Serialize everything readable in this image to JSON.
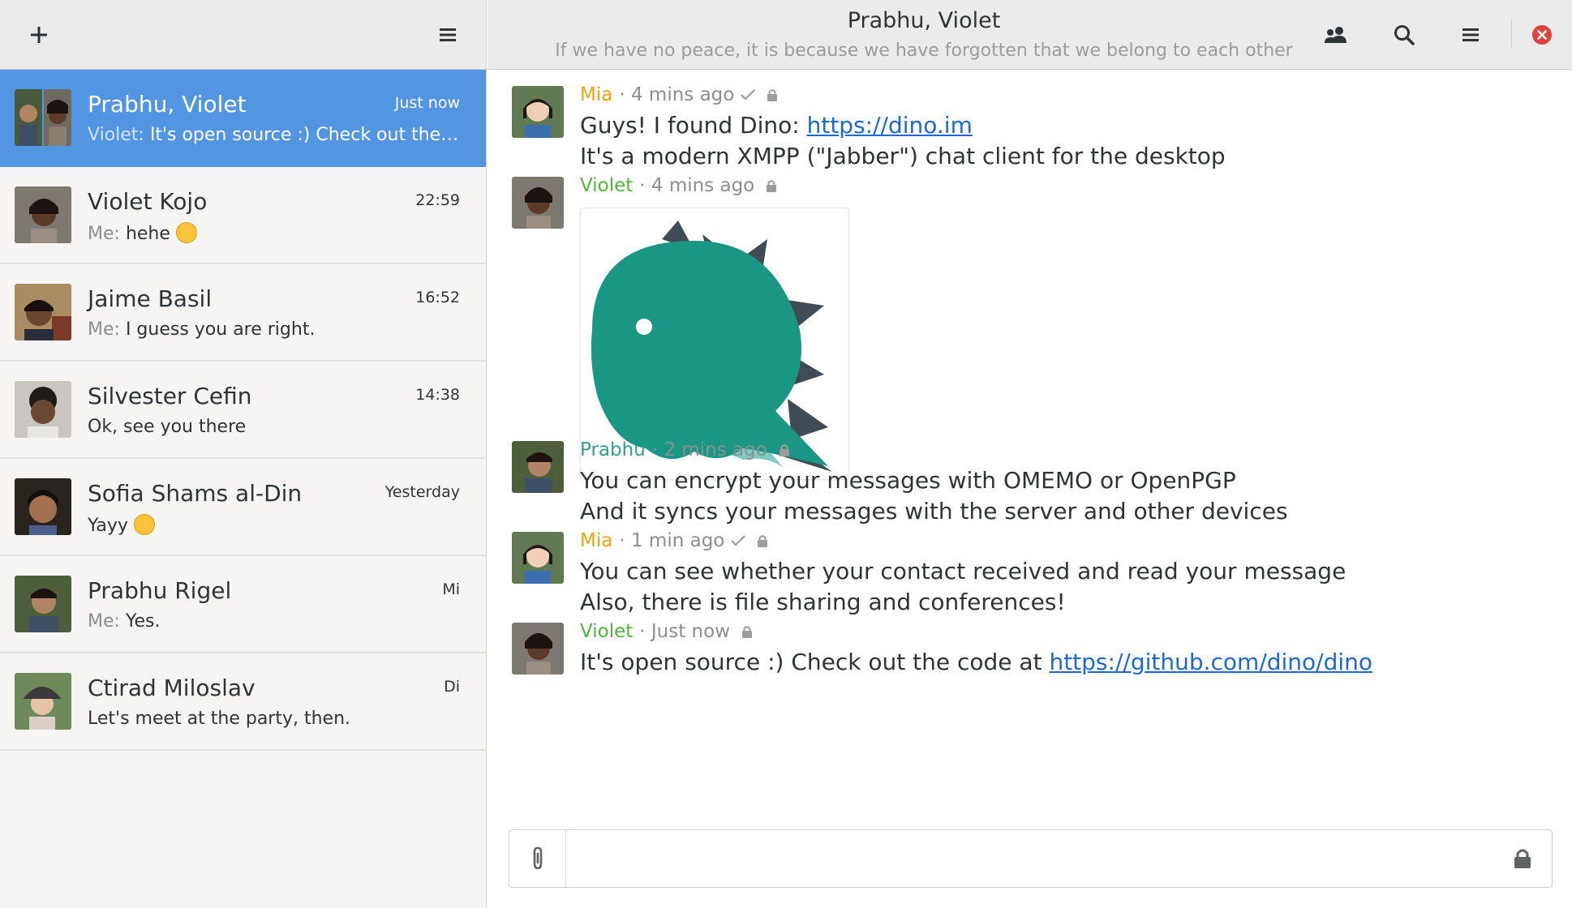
{
  "colors": {
    "accent": "#5295e0",
    "sender_orange": "#f4a00d",
    "sender_green": "#4fb63d",
    "sender_teal": "#329d8a",
    "link": "#1d69d1",
    "close_red": "#e0413f"
  },
  "sidebar": {
    "add_icon": "plus-icon",
    "menu_icon": "hamburger-menu-icon",
    "conversations": [
      {
        "name": "Prabhu, Violet",
        "time": "Just now",
        "prefix": "Violet:",
        "preview": "It's open source :) Check out the code at https://github.com/dino/dino",
        "selected": true
      },
      {
        "name": "Violet Kojo",
        "time": "22:59",
        "prefix": "Me:",
        "preview": "hehe",
        "emoji": "tongue-out-emoji"
      },
      {
        "name": "Jaime Basil",
        "time": "16:52",
        "prefix": "Me:",
        "preview": "I guess you are right."
      },
      {
        "name": "Silvester Cefin",
        "time": "14:38",
        "prefix": "",
        "preview": "Ok, see you there"
      },
      {
        "name": "Sofia Shams al-Din",
        "time": "Yesterday",
        "prefix": "",
        "preview": "Yayy",
        "emoji": "smiling-emoji"
      },
      {
        "name": "Prabhu Rigel",
        "time": "Mi",
        "prefix": "Me:",
        "preview": "Yes."
      },
      {
        "name": "Ctirad Miloslav",
        "time": "Di",
        "prefix": "",
        "preview": "Let's meet at the party, then."
      }
    ]
  },
  "header": {
    "title": "Prabhu, Violet",
    "subtitle": "If we have no peace, it is because we have forgotten that we belong to each other",
    "icons": [
      "occupants-icon",
      "search-icon",
      "hamburger-menu-icon",
      "close-icon"
    ]
  },
  "messages": [
    {
      "sender": "Mia",
      "meta": "· 4 mins ago",
      "status": "sent-check",
      "encrypted": true,
      "line1_text": "Guys! I found Dino: ",
      "line1_link": "https://dino.im",
      "line2": "It's a modern XMPP (\"Jabber\") chat client for the desktop"
    },
    {
      "sender": "Violet",
      "meta": "· 4 mins ago",
      "encrypted": true,
      "image": "dino-logo"
    },
    {
      "sender": "Prabhu",
      "meta": "· 2 mins ago",
      "encrypted": true,
      "line1": "You can encrypt your messages with OMEMO or OpenPGP",
      "line2": "And it syncs your messages with the server and other devices"
    },
    {
      "sender": "Mia",
      "meta": "· 1 min ago",
      "status": "sent-check",
      "encrypted": true,
      "line1": "You can see whether your contact received and read your message",
      "line2": "Also, there is file sharing and conferences!"
    },
    {
      "sender": "Violet",
      "meta": "· Just now",
      "encrypted": true,
      "line1_text": "It's open source :) Check out the code at ",
      "line1_link": "https://github.com/dino/dino"
    }
  ],
  "composer": {
    "value": "",
    "placeholder": "",
    "attach_icon": "paperclip-icon",
    "encryption_icon": "lock-icon"
  }
}
